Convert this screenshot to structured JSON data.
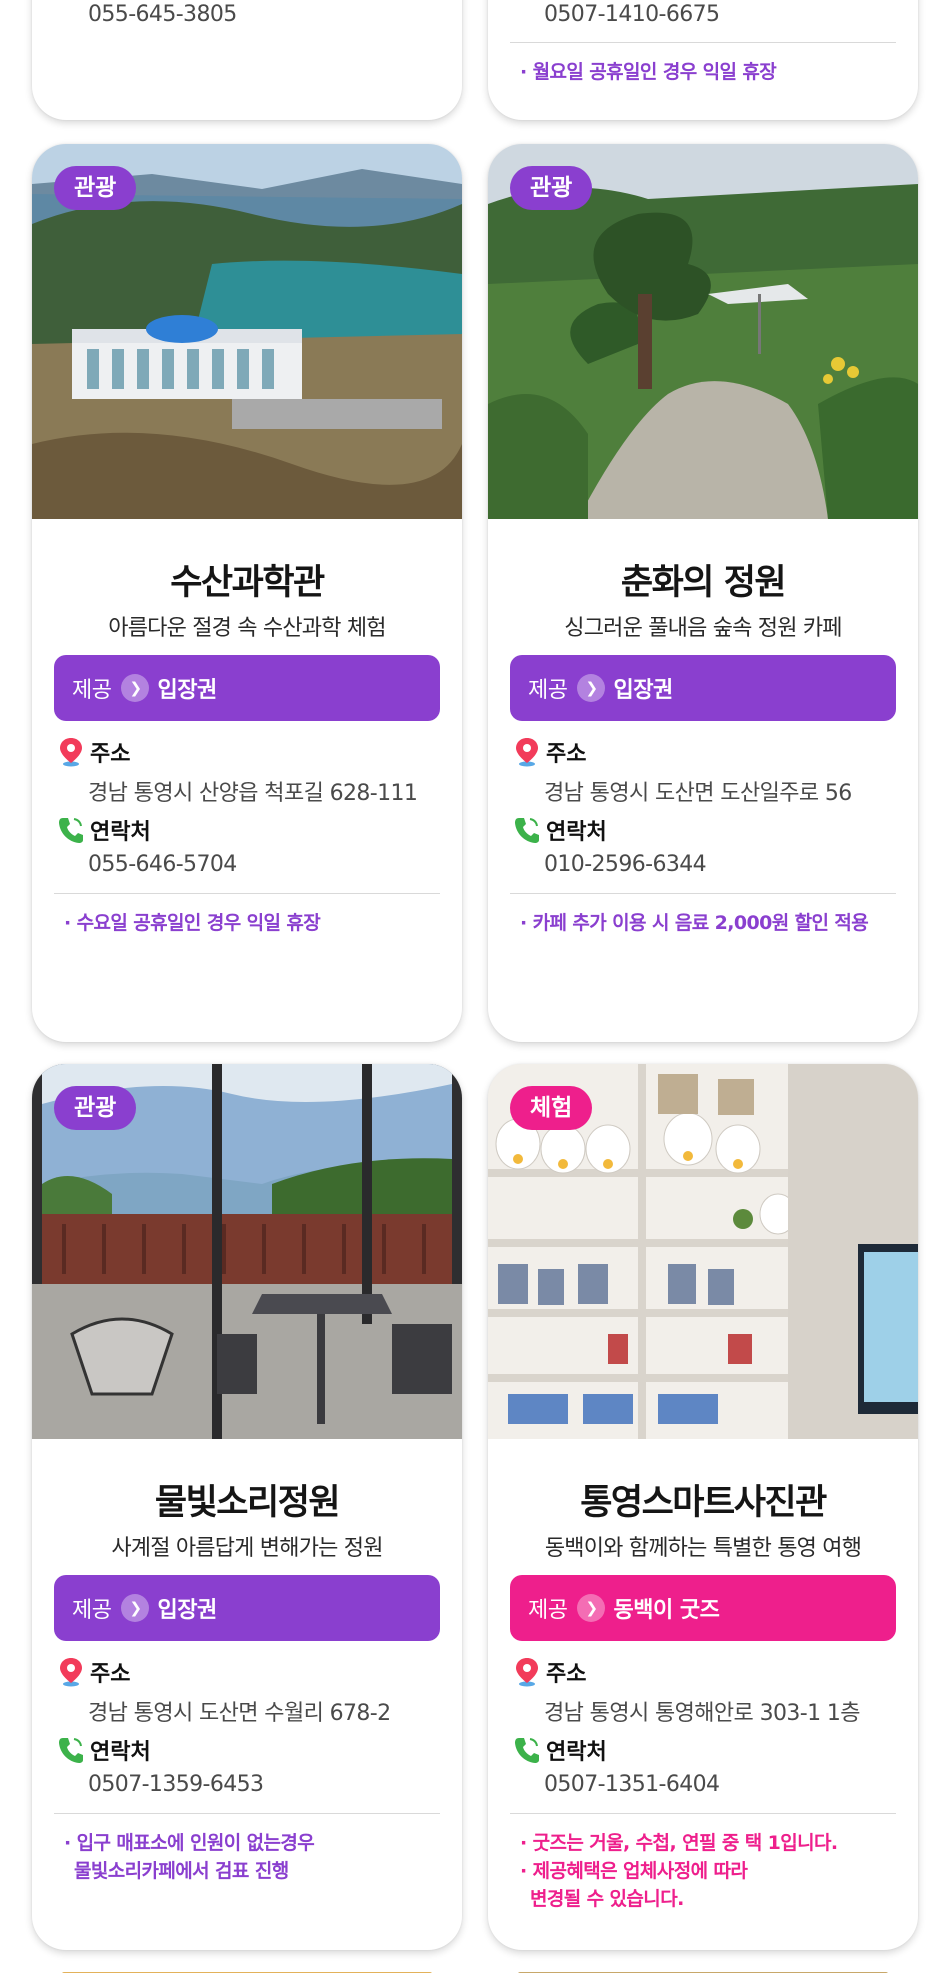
{
  "colors": {
    "purple": "#8a3fcf",
    "pink": "#ee1f8c",
    "note_purple": "#8a3fcf",
    "note_pink": "#ee1f8c"
  },
  "labels": {
    "offer_prefix": "제공",
    "address": "주소",
    "contact": "연락처"
  },
  "top_cards": [
    {
      "phone": "055-645-3805"
    },
    {
      "phone": "0507-1410-6675",
      "notes": [
        "· 월요일 공휴일인 경우 익일 휴장"
      ]
    }
  ],
  "cards": [
    {
      "category": "관광",
      "name": "수산과학관",
      "tagline": "아름다운 절경 속 수산과학 체험",
      "offer": "입장권",
      "address": "경남 통영시 산양읍 척포길 628-111",
      "phone": "055-646-5704",
      "notes": [
        "· 수요일 공휴일인 경우 익일 휴장"
      ]
    },
    {
      "category": "관광",
      "name": "춘화의 정원",
      "tagline": "싱그러운 풀내음 숲속 정원 카페",
      "offer": "입장권",
      "address": "경남 통영시 도산면 도산일주로 56",
      "phone": "010-2596-6344",
      "notes": [
        "· 카페 추가 이용 시 음료 2,000원 할인 적용"
      ]
    },
    {
      "category": "관광",
      "name": "물빛소리정원",
      "tagline": "사계절 아름답게 변해가는 정원",
      "offer": "입장권",
      "address": "경남 통영시 도산면 수월리 678-2",
      "phone": "0507-1359-6453",
      "notes": [
        "· 입구 매표소에 인원이 없는경우",
        "물빛소리카페에서 검표 진행"
      ]
    },
    {
      "category": "체험",
      "name": "통영스마트사진관",
      "tagline": "동백이와 함께하는 특별한 통영 여행",
      "offer": "동백이 굿즈",
      "address": "경남 통영시 통영해안로 303-1 1층",
      "phone": "0507-1351-6404",
      "notes": [
        "· 굿즈는 거울, 수첩, 연필 중 택 1입니다.",
        "· 제공혜택은 업체사정에 따라",
        "변경될 수 있습니다."
      ]
    }
  ]
}
